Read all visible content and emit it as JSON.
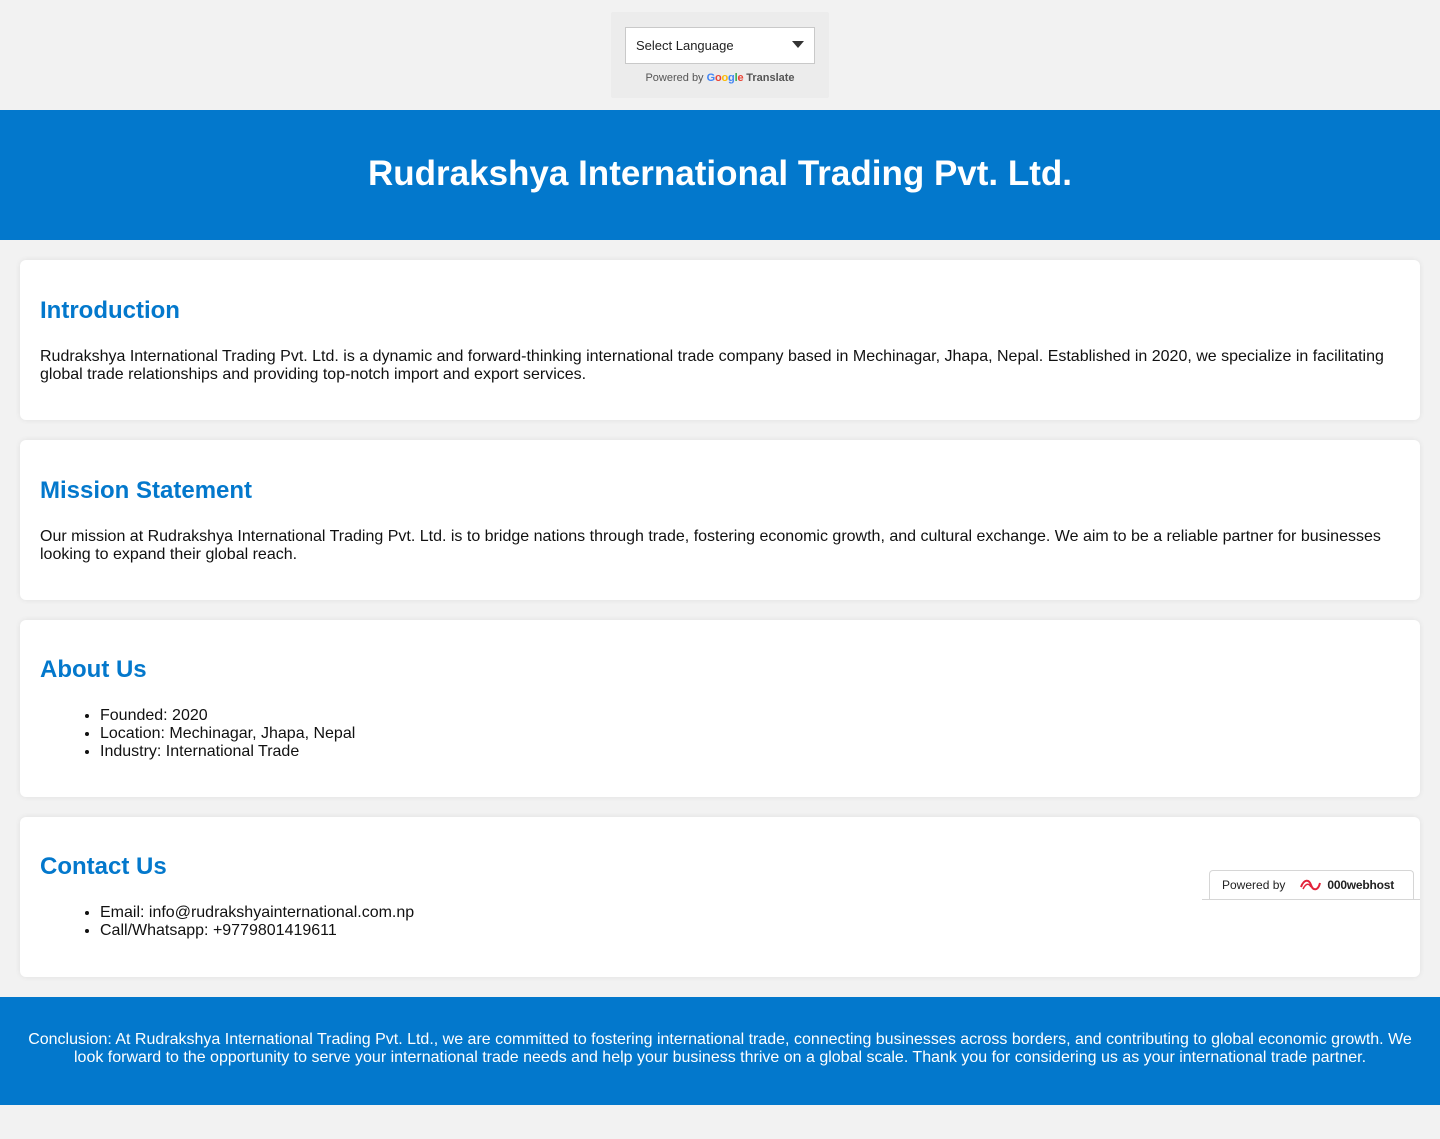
{
  "translate": {
    "select_label": "Select Language",
    "powered_by": "Powered by",
    "google": "Google",
    "translate_word": "Translate"
  },
  "header": {
    "title": "Rudrakshya International Trading Pvt. Ltd."
  },
  "sections": {
    "intro": {
      "heading": "Introduction",
      "text": "Rudrakshya International Trading Pvt. Ltd. is a dynamic and forward-thinking international trade company based in Mechinagar, Jhapa, Nepal. Established in 2020, we specialize in facilitating global trade relationships and providing top-notch import and export services."
    },
    "mission": {
      "heading": "Mission Statement",
      "text": "Our mission at Rudrakshya International Trading Pvt. Ltd. is to bridge nations through trade, fostering economic growth, and cultural exchange. We aim to be a reliable partner for businesses looking to expand their global reach."
    },
    "about": {
      "heading": "About Us",
      "items": [
        "Founded: 2020",
        "Location: Mechinagar, Jhapa, Nepal",
        "Industry: International Trade"
      ]
    },
    "contact": {
      "heading": "Contact Us",
      "items": [
        "Email: info@rudrakshyainternational.com.np",
        "Call/Whatsapp: +9779801419611"
      ]
    }
  },
  "badge": {
    "powered_by": "Powered by",
    "brand": "000webhost"
  },
  "footer": {
    "text": "Conclusion: At Rudrakshya International Trading Pvt. Ltd., we are committed to fostering international trade, connecting businesses across borders, and contributing to global economic growth. We look forward to the opportunity to serve your international trade needs and help your business thrive on a global scale. Thank you for considering us as your international trade partner."
  },
  "colors": {
    "brand_blue": "#0378cc",
    "page_bg": "#f2f2f2"
  }
}
